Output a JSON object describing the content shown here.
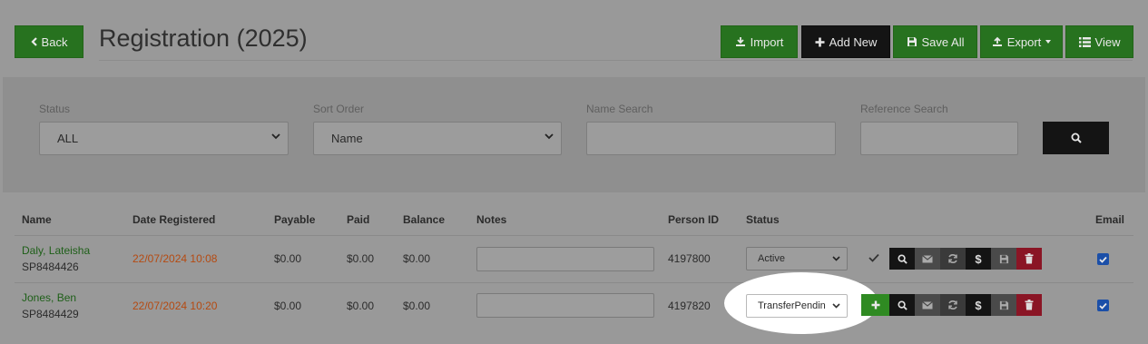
{
  "header": {
    "back_label": "Back",
    "title": "Registration (2025)",
    "toolbar": {
      "import_label": "Import",
      "add_new_label": "Add New",
      "save_all_label": "Save All",
      "export_label": "Export",
      "view_label": "View"
    }
  },
  "filters": {
    "status": {
      "label": "Status",
      "value": "ALL"
    },
    "sort_order": {
      "label": "Sort Order",
      "value": "Name"
    },
    "name_search": {
      "label": "Name Search",
      "value": ""
    },
    "reference_search": {
      "label": "Reference Search",
      "value": ""
    }
  },
  "table": {
    "columns": [
      "Name",
      "Date Registered",
      "Payable",
      "Paid",
      "Balance",
      "Notes",
      "Person ID",
      "Status",
      "Email"
    ],
    "rows": [
      {
        "name": "Daly, Lateisha",
        "ref": "SP8484426",
        "date": "22/07/2024 10:08",
        "payable": "$0.00",
        "paid": "$0.00",
        "balance": "$0.00",
        "notes": "",
        "person_id": "4197800",
        "status": "Active",
        "email_checked": true
      },
      {
        "name": "Jones, Ben",
        "ref": "SP8484429",
        "date": "22/07/2024 10:20",
        "payable": "$0.00",
        "paid": "$0.00",
        "balance": "$0.00",
        "notes": "",
        "person_id": "4197820",
        "status": "TransferPendin",
        "email_checked": true
      }
    ],
    "action_dollar": "$"
  },
  "colors": {
    "primary_green": "#27721f",
    "dark": "#141414",
    "danger": "#8a1525",
    "date_orange": "#b54a11",
    "highlight": "#ffffff"
  }
}
